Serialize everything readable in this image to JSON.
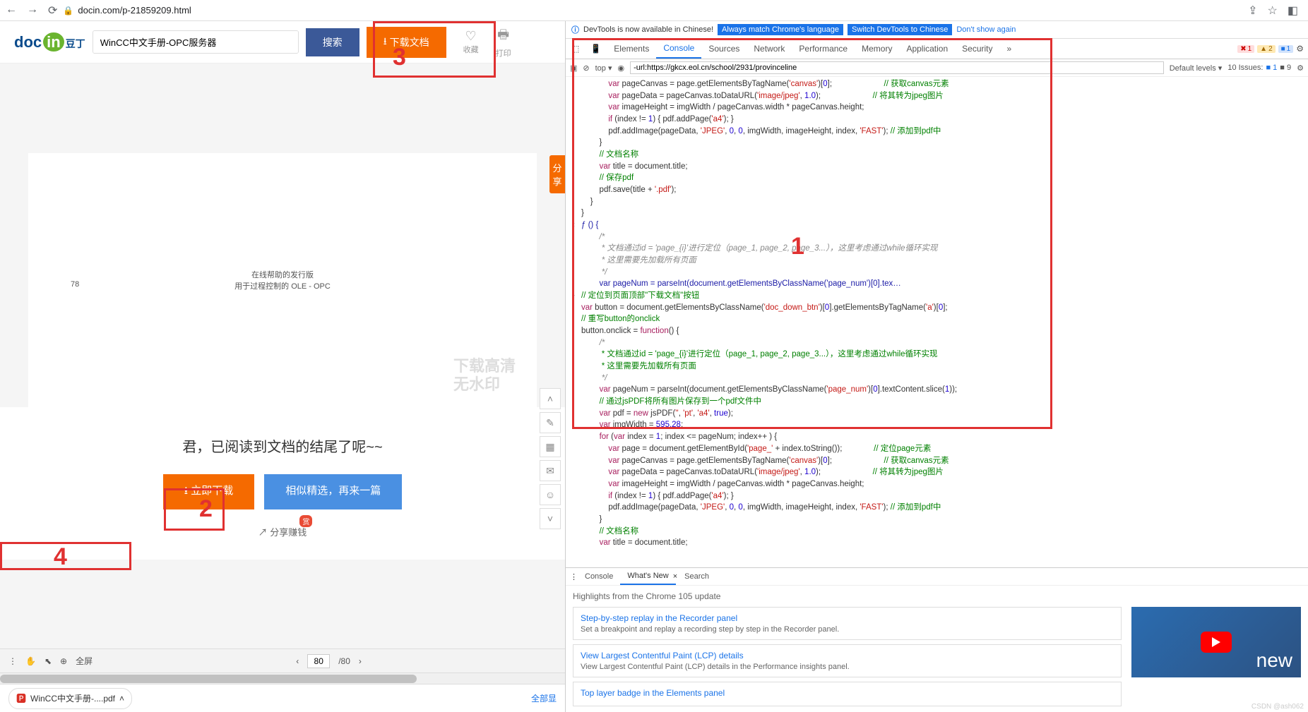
{
  "browser": {
    "url": "docin.com/p-21859209.html"
  },
  "header": {
    "logo1": "doc",
    "logo2": "in",
    "logo3": "豆丁",
    "search_value": "WinCC中文手册-OPC服务器",
    "search_btn": "搜索",
    "download_btn": "下载文档",
    "fav_label": "收藏",
    "print_label": "打印"
  },
  "share_tab": "分享",
  "page": {
    "num": "78",
    "line1": "在线帮助的发行版",
    "line2": "用于过程控制的 OLE  -  OPC",
    "watermark1": "下载高清",
    "watermark2": "无水印"
  },
  "end": {
    "title": "君，已阅读到文档的结尾了呢~~",
    "dl": "立即下载",
    "sim": "相似精选，再来一篇",
    "share": "分享赚钱",
    "share_badge": "赏"
  },
  "footer": {
    "fullscreen": "全屏",
    "page_cur": "80",
    "page_total": "/80"
  },
  "download_chip": "WinCC中文手册-....pdf",
  "download_all": "全部显",
  "devtools": {
    "infobar": {
      "text": "DevTools is now available in Chinese!",
      "btn1": "Always match Chrome's language",
      "btn2": "Switch DevTools to Chinese",
      "dont": "Don't show again"
    },
    "tabs": [
      "Elements",
      "Console",
      "Sources",
      "Network",
      "Performance",
      "Memory",
      "Application",
      "Security"
    ],
    "active_tab": "Console",
    "badges": {
      "err": "1",
      "warn": "2",
      "info": "1"
    },
    "filter": {
      "ctx": "top ▾",
      "input": "-url:https://gkcx.eol.cn/school/2931/provinceline",
      "levels": "Default levels ▾",
      "issues_label": "10 Issues:",
      "issues_info": "1",
      "issues_flag": "9"
    },
    "drawer": {
      "tabs": [
        "Console",
        "What's New",
        "Search"
      ],
      "active": "What's New",
      "headline": "Highlights from the Chrome 105 update",
      "cards": [
        {
          "t": "Step-by-step replay in the Recorder panel",
          "d": "Set a breakpoint and replay a recording step by step in the Recorder panel."
        },
        {
          "t": "View Largest Contentful Paint (LCP) details",
          "d": "View Largest Contentful Paint (LCP) details in the Performance insights panel."
        },
        {
          "t": "Top layer badge in the Elements panel",
          "d": ""
        }
      ],
      "video_label": "new"
    }
  },
  "annotations": {
    "n1": "1",
    "n2": "2",
    "n3": "3",
    "n4": "4"
  },
  "csdn": "CSDN @ash062",
  "console_lines": [
    {
      "g": "",
      "h": "            <span class='kw'>var</span> pageCanvas = page.getElementsByTagName(<span class='str'>'canvas'</span>)[<span class='num'>0</span>];                       <span class='cmt'>// 获取canvas元素</span>"
    },
    {
      "g": "",
      "h": "            <span class='kw'>var</span> pageData = pageCanvas.toDataURL(<span class='str'>'image/jpeg'</span>, <span class='num'>1.0</span>);                       <span class='cmt'>// 将其转为jpeg图片</span>"
    },
    {
      "g": "",
      "h": "            <span class='kw'>var</span> imageHeight = imgWidth / pageCanvas.width * pageCanvas.height;"
    },
    {
      "g": "",
      "h": "            <span class='kw'>if</span> (index != <span class='num'>1</span>) { pdf.addPage(<span class='str'>'a4'</span>); }"
    },
    {
      "g": "",
      "h": "            pdf.addImage(pageData, <span class='str'>'JPEG'</span>, <span class='num'>0</span>, <span class='num'>0</span>, imgWidth, imageHeight, index, <span class='str'>'FAST'</span>); <span class='cmt'>// 添加到pdf中</span>"
    },
    {
      "g": "",
      "h": "        }"
    },
    {
      "g": "",
      "h": ""
    },
    {
      "g": "",
      "h": "        <span class='cmt'>// 文档名称</span>"
    },
    {
      "g": "",
      "h": "        <span class='kw'>var</span> title = document.title;"
    },
    {
      "g": "",
      "h": ""
    },
    {
      "g": "",
      "h": "        <span class='cmt'>// 保存pdf</span>"
    },
    {
      "g": "",
      "h": "        pdf.save(title + <span class='str'>'.pdf'</span>);"
    },
    {
      "g": "",
      "h": "    }"
    },
    {
      "g": "",
      "h": "}"
    },
    {
      "g": "‹",
      "h": "<span class='fn'>ƒ () {</span>"
    },
    {
      "g": "",
      "h": "<span class='cmt-it'>        /*</span>"
    },
    {
      "g": "",
      "h": "<span class='cmt-it'>         * 文档通过id = 'page_{i}'进行定位（page_1, page_2, page_3...），这里考虑通过while循环实现</span>"
    },
    {
      "g": "",
      "h": "<span class='cmt-it'>         * 这里需要先加载所有页面</span>"
    },
    {
      "g": "",
      "h": "<span class='cmt-it'>         */</span>"
    },
    {
      "g": "",
      "h": "<span class='fn'>        var pageNum = parseInt(document.getElementsByClassName('page_num')[0].tex…</span>"
    },
    {
      "g": "›",
      "h": "<span class='cmt'>// 定位到页面顶部\"下载文档\"按钮</span>"
    },
    {
      "g": "",
      "h": "<span class='kw'>var</span> button = document.getElementsByClassName(<span class='str'>'doc_down_btn'</span>)[<span class='num'>0</span>].getElementsByTagName(<span class='str'>'a'</span>)[<span class='num'>0</span>];"
    },
    {
      "g": "",
      "h": ""
    },
    {
      "g": "",
      "h": "<span class='cmt'>// 重写button的onclick</span>"
    },
    {
      "g": "",
      "h": "button.onclick = <span class='kw'>function</span>() {"
    },
    {
      "g": "",
      "h": "        <span class='cmt-it'>/*</span>"
    },
    {
      "g": "",
      "h": "         <span class='cmt'>* 文档通过id = 'page_{i}'进行定位（page_1, page_2, page_3...），这里考虑通过while循环实现</span>"
    },
    {
      "g": "",
      "h": "         <span class='cmt'>* 这里需要先加载所有页面</span>"
    },
    {
      "g": "",
      "h": "         <span class='cmt-it'>*/</span>"
    },
    {
      "g": "",
      "h": "        <span class='kw'>var</span> pageNum = parseInt(document.getElementsByClassName(<span class='str'>'page_num'</span>)[<span class='num'>0</span>].textContent.slice(<span class='num'>1</span>));"
    },
    {
      "g": "",
      "h": ""
    },
    {
      "g": "",
      "h": "        <span class='cmt'>// 通过jsPDF将所有图片保存到一个pdf文件中</span>"
    },
    {
      "g": "",
      "h": "        <span class='kw'>var</span> pdf = <span class='kw'>new</span> jsPDF(<span class='str'>''</span>, <span class='str'>'pt'</span>, <span class='str'>'a4'</span>, <span class='num'>true</span>);"
    },
    {
      "g": "",
      "h": "        <span class='kw'>var</span> imgWidth = <span class='num'>595.28</span>;"
    },
    {
      "g": "",
      "h": "        <span class='kw'>for</span> (<span class='kw'>var</span> index = <span class='num'>1</span>; index &lt;= pageNum; index++ ) {"
    },
    {
      "g": "",
      "h": "            <span class='kw'>var</span> page = document.getElementById(<span class='str'>'page_'</span> + index.toString());              <span class='cmt'>// 定位page元素</span>"
    },
    {
      "g": "",
      "h": "            <span class='kw'>var</span> pageCanvas = page.getElementsByTagName(<span class='str'>'canvas'</span>)[<span class='num'>0</span>];                       <span class='cmt'>// 获取canvas元素</span>"
    },
    {
      "g": "",
      "h": "            <span class='kw'>var</span> pageData = pageCanvas.toDataURL(<span class='str'>'image/jpeg'</span>, <span class='num'>1.0</span>);                       <span class='cmt'>// 将其转为jpeg图片</span>"
    },
    {
      "g": "",
      "h": "            <span class='kw'>var</span> imageHeight = imgWidth / pageCanvas.width * pageCanvas.height;"
    },
    {
      "g": "",
      "h": "            <span class='kw'>if</span> (index != <span class='num'>1</span>) { pdf.addPage(<span class='str'>'a4'</span>); }"
    },
    {
      "g": "",
      "h": "            pdf.addImage(pageData, <span class='str'>'JPEG'</span>, <span class='num'>0</span>, <span class='num'>0</span>, imgWidth, imageHeight, index, <span class='str'>'FAST'</span>); <span class='cmt'>// 添加到pdf中</span>"
    },
    {
      "g": "",
      "h": "        }"
    },
    {
      "g": "",
      "h": ""
    },
    {
      "g": "",
      "h": "        <span class='cmt'>// 文档名称</span>"
    },
    {
      "g": "",
      "h": "        <span class='kw'>var</span> title = document.title;"
    }
  ]
}
